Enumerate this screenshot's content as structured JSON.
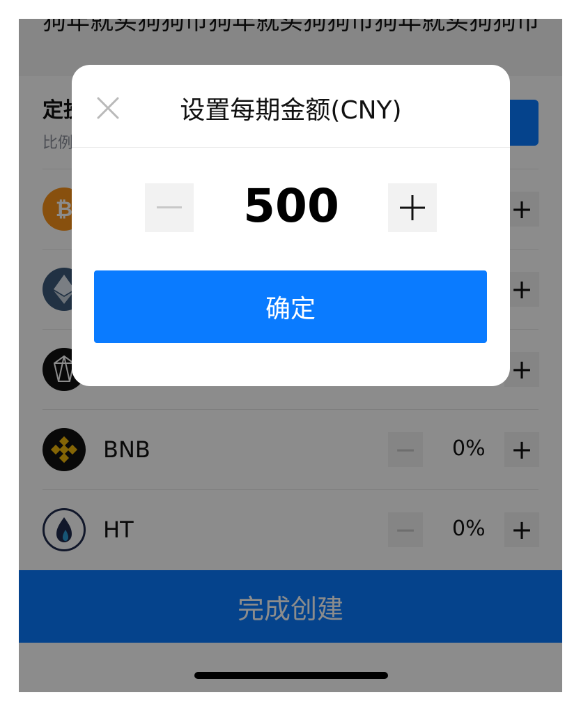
{
  "background": {
    "banner_text": "狗年就买狗狗币狗年就买狗狗币狗年就买狗狗币",
    "section_title": "定投",
    "section_subtitle": "比例",
    "coins": [
      {
        "name": "",
        "logo": "bitcoin-icon",
        "color": "#f7931a",
        "pct": ""
      },
      {
        "name": "",
        "logo": "ethereum-icon",
        "color": "#3c5a7a",
        "pct": ""
      },
      {
        "name": "",
        "logo": "eos-icon",
        "color": "#111111",
        "pct": ""
      },
      {
        "name": "BNB",
        "logo": "bnb-icon",
        "color": "#111111",
        "pct": "0%"
      },
      {
        "name": "HT",
        "logo": "huobi-token-icon",
        "color": "#1f2b4d",
        "pct": "0%"
      }
    ],
    "create_button": "完成创建"
  },
  "modal": {
    "title": "设置每期金额(CNY)",
    "amount": "500",
    "confirm_label": "确定"
  },
  "colors": {
    "accent": "#0a7bff",
    "overlay": "rgba(0,0,0,0.45)"
  }
}
